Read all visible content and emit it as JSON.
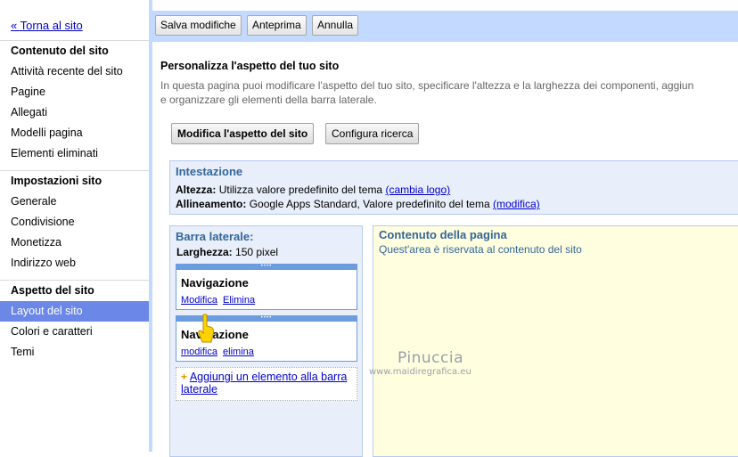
{
  "sidebar": {
    "back_link": "« Torna al sito",
    "sections": [
      {
        "heading": "Contenuto del sito",
        "items": [
          "Attività recente del sito",
          "Pagine",
          "Allegati",
          "Modelli pagina",
          "Elementi eliminati"
        ]
      },
      {
        "heading": "Impostazioni sito",
        "items": [
          "Generale",
          "Condivisione",
          "Monetizza",
          "Indirizzo web"
        ]
      },
      {
        "heading": "Aspetto del sito",
        "items": [
          "Layout del sito",
          "Colori e caratteri",
          "Temi"
        ],
        "selected": "Layout del sito"
      }
    ]
  },
  "toolbar": {
    "save_label": "Salva modifiche",
    "preview_label": "Anteprima",
    "cancel_label": "Annulla"
  },
  "main": {
    "title": "Personalizza l'aspetto del tuo sito",
    "description_line1": "In questa pagina puoi modificare l'aspetto del tuo sito, specificare l'altezza e la larghezza dei componenti, aggiun",
    "description_line2": "e organizzare gli elementi della barra laterale.",
    "modify_appearance_label": "Modifica l'aspetto del sito",
    "configure_search_label": "Configura ricerca"
  },
  "header": {
    "title": "Intestazione",
    "height_label": "Altezza:",
    "height_value": "Utilizza valore predefinito del tema",
    "height_link": "(cambia logo)",
    "alignment_label": "Allineamento:",
    "alignment_value": "Google Apps Standard, Valore predefinito del tema",
    "alignment_link": "(modifica)"
  },
  "sidebar_panel": {
    "title": "Barra laterale:",
    "width_label": "Larghezza:",
    "width_value": "150 pixel",
    "widgets": [
      {
        "title": "Navigazione",
        "edit_link": "Modifica",
        "delete_link": "Elimina"
      },
      {
        "title": "Navigazione",
        "edit_link": "modifica",
        "delete_link": "elimina"
      }
    ],
    "add_widget_label": "Aggiungi un elemento alla barra laterale"
  },
  "content_panel": {
    "title": "Contenuto della pagina",
    "description": "Quest'area è riservata al contenuto del sito"
  },
  "watermark": {
    "name": "Pinuccia",
    "url": "www.maidiregrafica.eu"
  },
  "colors": {
    "toolbar_bg": "#c3d9ff",
    "selected_nav": "#6b87e8",
    "section_blue": "#336699",
    "content_bg": "#ffffe0"
  }
}
